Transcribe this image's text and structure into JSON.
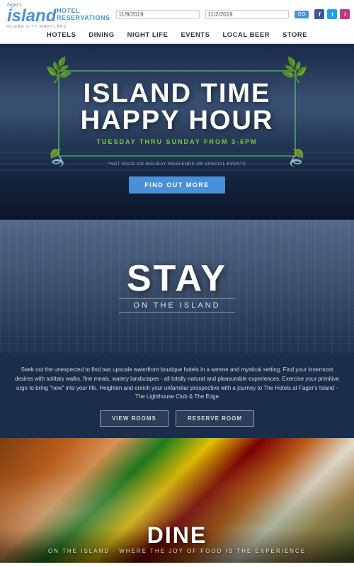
{
  "header": {
    "logo_fagers": "fager's",
    "logo_island": "island",
    "logo_location": "OCEAN CITY MARYLAND",
    "hotel_reservations_label": "HOTEL RESERVATIONS",
    "date_checkin": "11/9/2019",
    "date_checkout": "11/2/2019",
    "search_btn_label": "GO"
  },
  "nav": {
    "items": [
      {
        "label": "HOTELS"
      },
      {
        "label": "DINING"
      },
      {
        "label": "NIGHT LIFE"
      },
      {
        "label": "EVENTS"
      },
      {
        "label": "LOCAL BEER"
      },
      {
        "label": "STORE"
      }
    ]
  },
  "hero": {
    "title_line1": "ISLAND TIME",
    "title_line2": "HAPPY HOUR",
    "subtitle": "TUESDAY THRU SUNDAY FROM 3-6PM",
    "disclaimer": "*NOT VALID ON HOLIDAY WEEKENDS OR SPECIAL EVENTS",
    "cta_label": "FIND OUT MORE"
  },
  "stay": {
    "title": "STAY",
    "subtitle": "ON THE ISLAND"
  },
  "hotel_info": {
    "description": "Seek out the unexpected to find two upscale waterfront boutique hotels in a serene and mystical setting. Find your innermost desires with solitary walks, fine meals, watery landscapes - all totally natural and pleasurable experiences. Exercise your primitive urge to bring \"new\" into your life. Heighten and enrich your unfamiliar prospective with a journey to The Hotels at Fager's Island - The Lighthouse Club & The Edge",
    "btn_view_rooms": "VIEW ROOMS",
    "btn_reserve_room": "RESERVE ROOM"
  },
  "food": {
    "title": "DINE",
    "subtitle": "on the island · where the joy of food is the experience"
  },
  "social": {
    "facebook": "f",
    "twitter": "t",
    "instagram": "i"
  },
  "colors": {
    "brand_blue": "#4a90d9",
    "brand_green": "#7dc832",
    "dark_navy": "#1a2d4a"
  }
}
